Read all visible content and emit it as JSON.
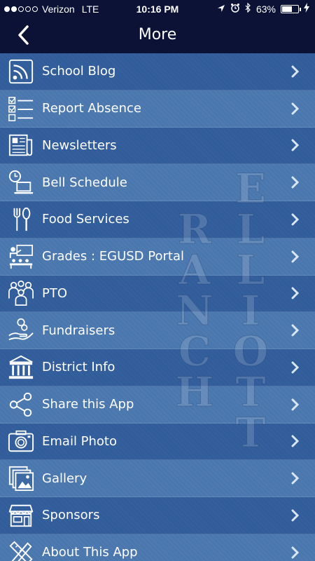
{
  "status_bar": {
    "carrier": "Verizon",
    "network": "LTE",
    "time": "10:16 PM",
    "battery": "63%",
    "battery_level": 0.63,
    "signal_bars_filled": 2,
    "signal_bars_total": 5
  },
  "navbar": {
    "title": "More",
    "back_icon": "chevron-left-icon"
  },
  "watermark": "ELLIOTT RANCH",
  "colors": {
    "bar_background": "#0b1236",
    "list_background": "#3d6aa3",
    "text": "#ffffff"
  },
  "menu": {
    "items": [
      {
        "label": "School Blog",
        "icon": "rss-icon"
      },
      {
        "label": "Report Absence",
        "icon": "checklist-icon"
      },
      {
        "label": "Newsletters",
        "icon": "newspaper-icon"
      },
      {
        "label": "Bell Schedule",
        "icon": "clock-laptop-icon"
      },
      {
        "label": "Food Services",
        "icon": "fork-spoon-icon"
      },
      {
        "label": "Grades : EGUSD Portal",
        "icon": "classroom-icon"
      },
      {
        "label": "PTO",
        "icon": "people-icon"
      },
      {
        "label": "Fundraisers",
        "icon": "hand-coins-icon"
      },
      {
        "label": "District Info",
        "icon": "building-icon"
      },
      {
        "label": "Share this App",
        "icon": "share-icon"
      },
      {
        "label": "Email Photo",
        "icon": "camera-icon"
      },
      {
        "label": "Gallery",
        "icon": "photos-icon"
      },
      {
        "label": "Sponsors",
        "icon": "storefront-icon"
      },
      {
        "label": "About This App",
        "icon": "pencil-ruler-icon"
      }
    ]
  }
}
